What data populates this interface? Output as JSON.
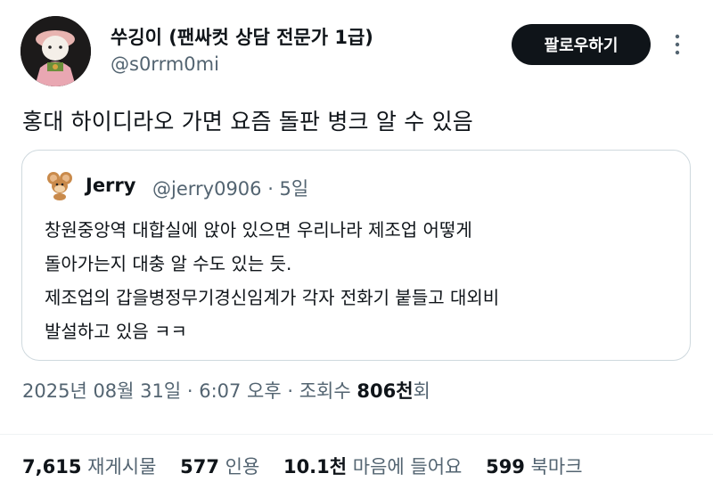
{
  "header": {
    "display_name": "쑤깅이 (팬싸컷 상담 전문가 1급)",
    "handle": "@s0rrm0mi",
    "follow_label": "팔로우하기"
  },
  "tweet": {
    "text": "홍대 하이디라오 가면 요즘 돌판 병크 알 수 있음"
  },
  "quote": {
    "name": "Jerry",
    "meta": "@jerry0906 · 5일",
    "lines": [
      "창원중앙역 대합실에 앉아 있으면 우리나라 제조업 어떻게",
      "돌아가는지 대충 알 수도 있는 듯.",
      "제조업의 갑을병정무기경신임계가 각자 전화기 붙들고 대외비",
      "발설하고 있음 ㅋㅋ"
    ]
  },
  "meta": {
    "timestamp": "2025년 08월 31일 · 6:07 오후 · 조회수 ",
    "views_num": "806천",
    "views_suffix": "회"
  },
  "stats": {
    "retweets_num": "7,615",
    "retweets_label": "재게시물",
    "quotes_num": "577",
    "quotes_label": "인용",
    "likes_num": "10.1천",
    "likes_label": "마음에 들어요",
    "bookmarks_num": "599",
    "bookmarks_label": "북마크"
  },
  "colors": {
    "text_primary": "#0f1419",
    "text_secondary": "#536471",
    "border": "#cfd9de",
    "button_bg": "#0f1419"
  },
  "icons": {
    "profile": "avatar-plush-doll",
    "quote_profile": "avatar-jerry-mouse",
    "more": "more-vertical-icon"
  }
}
